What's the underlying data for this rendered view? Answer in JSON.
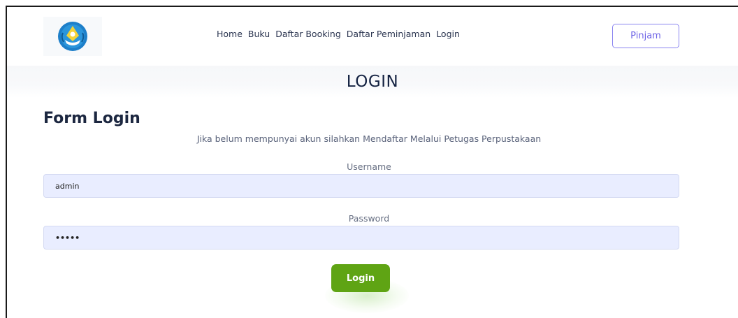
{
  "header": {
    "logo_alt": "Tut Wuri Handayani logo",
    "nav": {
      "home": "Home",
      "buku": "Buku",
      "daftar_booking": "Daftar Booking",
      "daftar_peminjaman": "Daftar Peminjaman",
      "login": "Login"
    },
    "pinjam_label": "Pinjam"
  },
  "page": {
    "title": "LOGIN"
  },
  "form": {
    "title": "Form Login",
    "hint": "Jika belum mempunyai akun silahkan Mendaftar Melalui Petugas Perpustakaan",
    "username_label": "Username",
    "username_value": "admin",
    "password_label": "Password",
    "password_value": "•••••",
    "submit_label": "Login"
  },
  "colors": {
    "accent": "#6d63e6",
    "login_button": "#5fa414",
    "input_bg": "#e9edff"
  }
}
